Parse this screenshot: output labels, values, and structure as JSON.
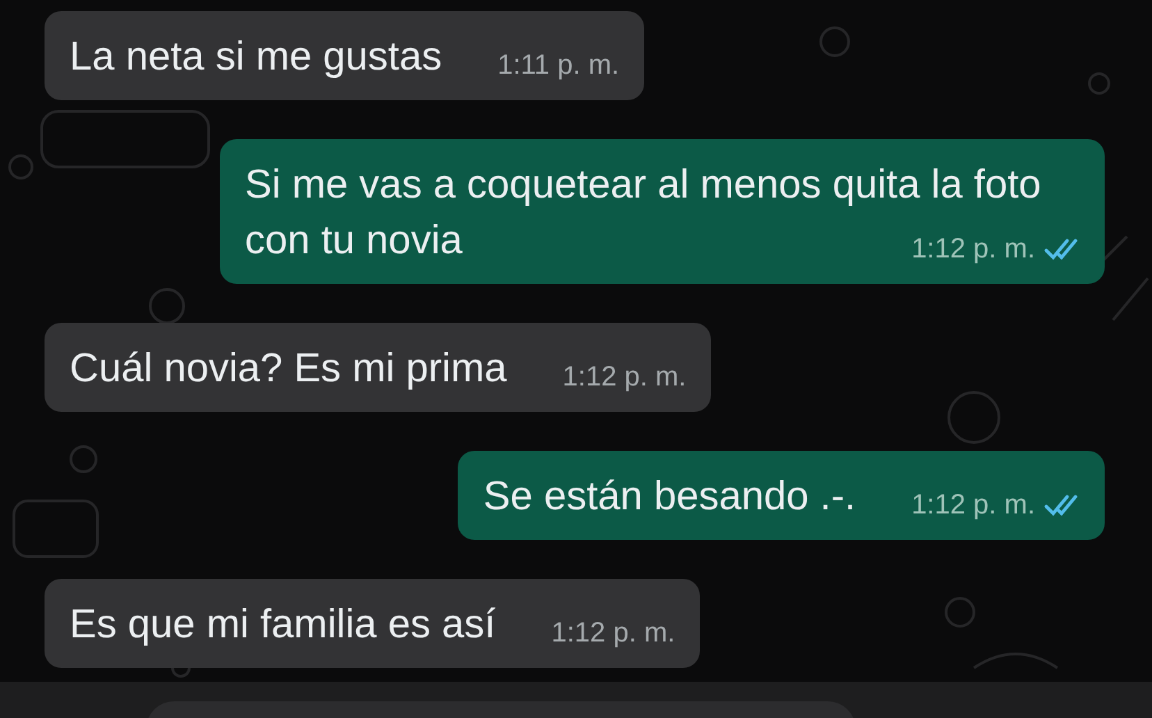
{
  "messages": [
    {
      "kind": "incoming",
      "text": "La neta si me gustas",
      "time": "1:11 p. m."
    },
    {
      "kind": "outgoing",
      "text": "Si me vas a coquetear al menos quita la foto con tu novia",
      "time": "1:12 p. m.",
      "read": true
    },
    {
      "kind": "incoming",
      "text": "Cuál novia? Es mi prima",
      "time": "1:12 p. m."
    },
    {
      "kind": "outgoing",
      "text": "Se están besando .-.",
      "time": "1:12 p. m.",
      "read": true
    },
    {
      "kind": "incoming",
      "text": "Es que mi familia es así",
      "time": "1:12 p. m."
    }
  ]
}
